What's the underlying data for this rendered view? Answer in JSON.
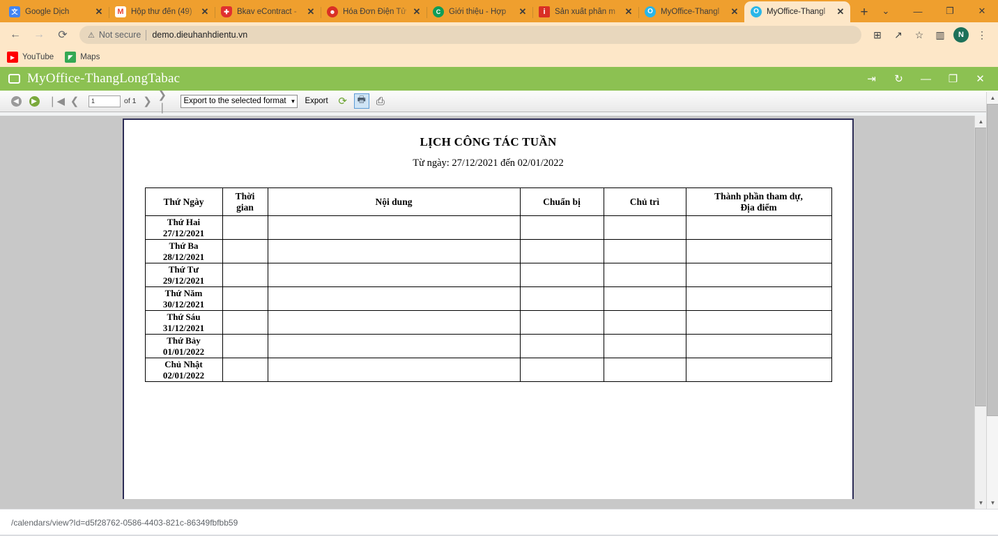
{
  "browser": {
    "tabs": [
      {
        "label": "Google Dịch",
        "favicon": "google-translate-icon",
        "favicon_color": "#4285f4",
        "favicon_glyph": "文",
        "active": false
      },
      {
        "label": "Hộp thư đến (49)",
        "favicon": "gmail-icon",
        "favicon_color": "#ffffff",
        "favicon_glyph": "M",
        "active": false
      },
      {
        "label": "Bkav eContract -",
        "favicon": "bkav-shield-icon",
        "favicon_color": "#e03030",
        "favicon_glyph": "+",
        "active": false
      },
      {
        "label": "Hóa Đơn Điện Tử",
        "favicon": "invoice-icon",
        "favicon_color": "#d93025",
        "favicon_glyph": "☻",
        "active": false
      },
      {
        "label": "Giới thiệu - Hợp",
        "favicon": "circle-c-icon",
        "favicon_color": "#0f9d58",
        "favicon_glyph": "C",
        "active": false
      },
      {
        "label": "Sản xuất phần m",
        "favicon": "info-icon",
        "favicon_color": "#d93025",
        "favicon_glyph": "i",
        "active": false
      },
      {
        "label": "MyOffice-Thangl",
        "favicon": "myoffice-icon",
        "favicon_color": "#29b6e8",
        "favicon_glyph": "O",
        "active": false
      },
      {
        "label": "MyOffice-Thangl",
        "favicon": "myoffice-icon",
        "favicon_color": "#29b6e8",
        "favicon_glyph": "O",
        "active": true
      }
    ],
    "tab_close_glyph": "✕",
    "new_tab_label": "+",
    "window_controls": [
      {
        "name": "tab-search-button",
        "glyph": "⌄"
      },
      {
        "name": "minimize-button",
        "glyph": "—"
      },
      {
        "name": "maximize-button",
        "glyph": "❐"
      },
      {
        "name": "close-window-button",
        "glyph": "✕"
      }
    ],
    "nav": {
      "back_glyph": "←",
      "forward_glyph": "→",
      "reload_glyph": "⟳"
    },
    "omnibox": {
      "warning_glyph": "⚠",
      "security_label": "Not secure",
      "url": "demo.dieuhanhdientu.vn"
    },
    "toolbar_icons": [
      {
        "name": "translate-icon",
        "glyph": "⊞"
      },
      {
        "name": "share-icon",
        "glyph": "↗"
      },
      {
        "name": "bookmark-star-icon",
        "glyph": "☆"
      },
      {
        "name": "side-panel-icon",
        "glyph": "▥"
      }
    ],
    "profile_initial": "N",
    "menu_glyph": "⋮",
    "bookmarks": [
      {
        "label": "YouTube",
        "icon": "youtube-icon",
        "color": "#ff0000",
        "glyph": "▶"
      },
      {
        "label": "Maps",
        "icon": "google-maps-icon",
        "color": "#34a853",
        "glyph": "📍"
      }
    ]
  },
  "app": {
    "title": "MyOffice-ThangLongTabac",
    "window_icon": "window-rect-icon",
    "controls": [
      {
        "name": "pin-button",
        "glyph": "⇥"
      },
      {
        "name": "refresh-button",
        "glyph": "↻"
      },
      {
        "name": "minimize-button",
        "glyph": "—"
      },
      {
        "name": "restore-button",
        "glyph": "❐"
      },
      {
        "name": "close-button",
        "glyph": "✕"
      }
    ]
  },
  "report_toolbar": {
    "back_glyph": "◀",
    "forward_glyph": "▶",
    "first_page_glyph": "❘◀",
    "prev_page_glyph": "❮",
    "page_number": "1",
    "of_label": "of 1",
    "next_page_glyph": "❯",
    "last_page_glyph": "❯❘",
    "format_select_value": "Export to the selected format",
    "format_select_caret": "▼",
    "export_label": "Export",
    "refresh_icon": "refresh-icon",
    "refresh_glyph": "⟳",
    "print_preview_icon": "print-preview-icon",
    "print_preview_glyph": "🖶",
    "print_icon": "printer-icon",
    "print_glyph": "⎙"
  },
  "document": {
    "title": "LỊCH CÔNG TÁC TUẦN",
    "subtitle": "Từ ngày: 27/12/2021 đến 02/01/2022",
    "table": {
      "headers": [
        "Thứ Ngày",
        "Thời gian",
        "Nội dung",
        "Chuẩn bị",
        "Chủ trì",
        "Thành phần tham dự, Địa điểm"
      ],
      "header_lines": [
        [
          "Thứ Ngày"
        ],
        [
          "Thời",
          "gian"
        ],
        [
          "Nội dung"
        ],
        [
          "Chuẩn bị"
        ],
        [
          "Chủ trì"
        ],
        [
          "Thành phần tham dự,",
          "Địa điểm"
        ]
      ],
      "rows": [
        {
          "day": "Thứ Hai",
          "date": "27/12/2021",
          "time": "",
          "content": "",
          "prep": "",
          "chair": "",
          "participants": ""
        },
        {
          "day": "Thứ Ba",
          "date": "28/12/2021",
          "time": "",
          "content": "",
          "prep": "",
          "chair": "",
          "participants": ""
        },
        {
          "day": "Thứ Tư",
          "date": "29/12/2021",
          "time": "",
          "content": "",
          "prep": "",
          "chair": "",
          "participants": ""
        },
        {
          "day": "Thứ Năm",
          "date": "30/12/2021",
          "time": "",
          "content": "",
          "prep": "",
          "chair": "",
          "participants": ""
        },
        {
          "day": "Thứ Sáu",
          "date": "31/12/2021",
          "time": "",
          "content": "",
          "prep": "",
          "chair": "",
          "participants": ""
        },
        {
          "day": "Thứ Bảy",
          "date": "01/01/2022",
          "time": "",
          "content": "",
          "prep": "",
          "chair": "",
          "participants": ""
        },
        {
          "day": "Chủ Nhật",
          "date": "02/01/2022",
          "time": "",
          "content": "",
          "prep": "",
          "chair": "",
          "participants": ""
        }
      ]
    }
  },
  "status_bar": {
    "url": "/calendars/view?Id=d5f28762-0586-4403-821c-86349fbfbb59"
  },
  "scrollbar": {
    "up_glyph": "▲",
    "down_glyph": "▼"
  },
  "colors": {
    "app_header": "#8cc152",
    "browser_chrome": "#ef9f2e",
    "browser_toolbar": "#fde7c8",
    "page_border": "#2c2c56",
    "viewport_bg": "#c8c8c8"
  }
}
